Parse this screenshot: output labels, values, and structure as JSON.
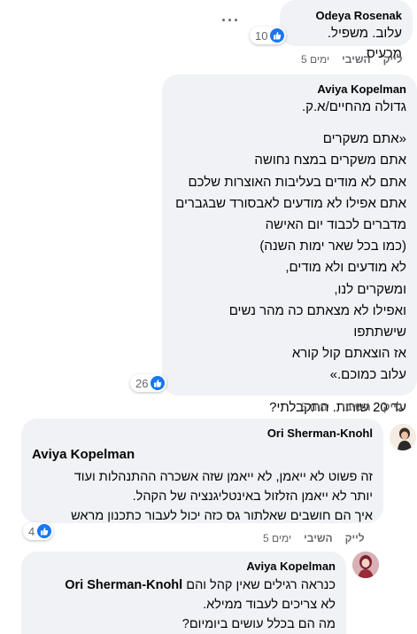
{
  "comments": [
    {
      "author": "Odeya Rosenak",
      "lines": [
        "עלוב. משפיל. מכעיס."
      ],
      "reactions": "10",
      "actions": {
        "like": "לייק",
        "reply": "השיבי",
        "time": "5 ימים"
      }
    },
    {
      "author": "Aviya Kopelman",
      "lines": [
        "גדולה מהחיים/א.ק.",
        "",
        "«אתם משקרים",
        "אתם משקרים במצח נחושה",
        "אתם לא מודים בעליבות האוצרות שלכם",
        "אתם אפילו לא מודעים לאבסורד שבגברים",
        "מדברים לכבוד יום האישה",
        "(כמו בכל שאר ימות השנה)",
        "לא מודעים ולא מודים,",
        "ומשקרים לנו,",
        "ואפילו לא מצאתם כה מהר נשים",
        "שישתתפו",
        "אז הוצאתם קול קורא",
        "עלוב כמוכם.»",
        "",
        "עד 20 שורות. התקבלתי?"
      ],
      "reactions": "26",
      "actions": {
        "like": "לייק",
        "reply": "השיבי",
        "time": "5 ימים"
      }
    },
    {
      "author": "Ori Sherman-Knohl",
      "mention": "Aviya Kopelman",
      "lines": [
        "זה פשוט לא ייאמן, לא ייאמן שזה אשכרה ההתנהלות ועוד",
        "יותר לא ייאמן הזלזול באינטליגנציה של הקהל.",
        "איך הם חושבים שאלתור גס כזה יכול לעבור כתכנון מראש"
      ],
      "reactions": "4",
      "actions": {
        "like": "לייק",
        "reply": "השיבי",
        "time": "5 ימים"
      }
    },
    {
      "author": "Aviya Kopelman",
      "mention": "Ori Sherman-Knohl",
      "first_line_rest": "כנראה רגילים שאין קהל והם",
      "lines": [
        "לא צריכים לעבוד ממילא.",
        "מה הם בכלל עושים ביומיום?"
      ]
    }
  ],
  "colors": {
    "bubble": "#f0f2f5",
    "like": "#1877f2",
    "meta": "#65676b"
  },
  "icons": {
    "more": "more-options-icon",
    "like": "like-thumb-icon"
  }
}
